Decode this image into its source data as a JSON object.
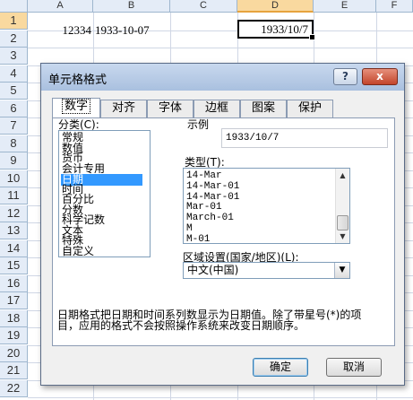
{
  "spreadsheet": {
    "columns": [
      "A",
      "B",
      "C",
      "D",
      "E",
      "F"
    ],
    "selected_column": "D",
    "rows": [
      "1",
      "2",
      "3",
      "4",
      "5",
      "6",
      "7",
      "8",
      "9",
      "10",
      "11",
      "12",
      "13",
      "14",
      "15",
      "16",
      "17",
      "18",
      "19",
      "20",
      "21",
      "22"
    ],
    "cell_a1": "12334",
    "cell_b1": "1933-10-07",
    "cell_d1": "1933/10/7"
  },
  "dialog": {
    "title": "单元格格式",
    "help_icon": "?",
    "close_icon": "x",
    "tabs": [
      "数字",
      "对齐",
      "字体",
      "边框",
      "图案",
      "保护"
    ],
    "active_tab": "数字",
    "category_label": "分类(C):",
    "categories": [
      "常规",
      "数值",
      "货币",
      "会计专用",
      "日期",
      "时间",
      "百分比",
      "分数",
      "科学记数",
      "文本",
      "特殊",
      "自定义"
    ],
    "selected_category": "日期",
    "sample_label": "示例",
    "sample_value": "1933/10/7",
    "type_label": "类型(T):",
    "types": [
      "14-Mar",
      "14-Mar-01",
      "14-Mar-01",
      "Mar-01",
      "March-01",
      "M",
      "M-01"
    ],
    "locale_label": "区域设置(国家/地区)(L):",
    "locale_value": "中文(中国)",
    "description": "日期格式把日期和时间系列数显示为日期值。除了带星号(*)的项目，应用的格式不会按照操作系统来改变日期顺序。",
    "ok_label": "确定",
    "cancel_label": "取消"
  }
}
